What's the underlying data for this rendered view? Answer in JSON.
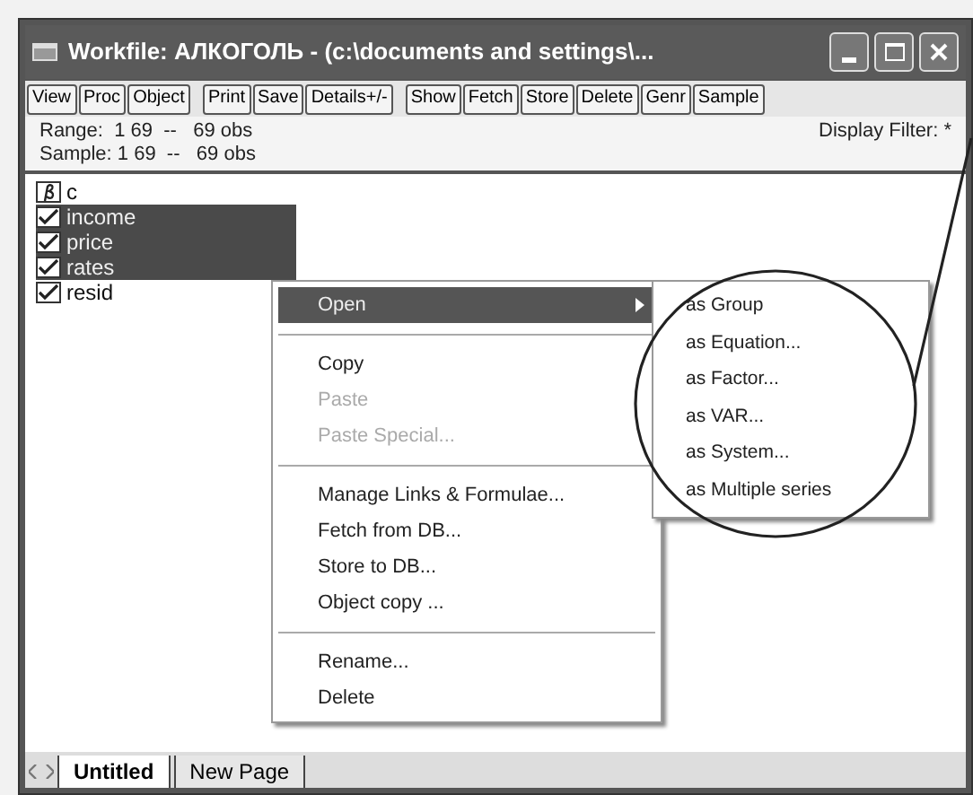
{
  "window": {
    "title": "Workfile: АЛКОГОЛЬ - (c:\\documents and settings\\..."
  },
  "toolbar": [
    [
      "View",
      "Proc",
      "Object"
    ],
    [
      "Print",
      "Save",
      "Details+/-"
    ],
    [
      "Show",
      "Fetch",
      "Store",
      "Delete",
      "Genr",
      "Sample"
    ]
  ],
  "info": {
    "range": "Range:  1 69  --   69 obs",
    "sample": "Sample: 1 69  --   69 obs",
    "filter": "Display Filter: *"
  },
  "objects": [
    {
      "name": "c",
      "kind": "coef",
      "selected": false
    },
    {
      "name": "income",
      "kind": "series",
      "selected": true
    },
    {
      "name": "price",
      "kind": "series",
      "selected": true
    },
    {
      "name": "rates",
      "kind": "series",
      "selected": true
    },
    {
      "name": "resid",
      "kind": "series",
      "selected": false
    }
  ],
  "context_menu": [
    {
      "kind": "item",
      "label": "Open",
      "submenu": true,
      "selected": true,
      "disabled": false
    },
    {
      "kind": "separator"
    },
    {
      "kind": "item",
      "label": "Copy",
      "submenu": false,
      "selected": false,
      "disabled": false
    },
    {
      "kind": "item",
      "label": "Paste",
      "submenu": false,
      "selected": false,
      "disabled": true
    },
    {
      "kind": "item",
      "label": "Paste Special...",
      "submenu": false,
      "selected": false,
      "disabled": true
    },
    {
      "kind": "separator"
    },
    {
      "kind": "item",
      "label": "Manage Links & Formulae...",
      "submenu": false,
      "selected": false,
      "disabled": false
    },
    {
      "kind": "item",
      "label": "Fetch from DB...",
      "submenu": false,
      "selected": false,
      "disabled": false
    },
    {
      "kind": "item",
      "label": "Store to DB...",
      "submenu": false,
      "selected": false,
      "disabled": false
    },
    {
      "kind": "item",
      "label": "Object copy ...",
      "submenu": false,
      "selected": false,
      "disabled": false
    },
    {
      "kind": "separator"
    },
    {
      "kind": "item",
      "label": "Rename...",
      "submenu": false,
      "selected": false,
      "disabled": false
    },
    {
      "kind": "item",
      "label": "Delete",
      "submenu": false,
      "selected": false,
      "disabled": false
    }
  ],
  "submenu": [
    "as Group",
    "as Equation...",
    "as Factor...",
    "as VAR...",
    "as System...",
    "as Multiple series"
  ],
  "page_tabs": [
    {
      "label": "Untitled",
      "selected": true
    },
    {
      "label": "New Page",
      "selected": false
    }
  ]
}
